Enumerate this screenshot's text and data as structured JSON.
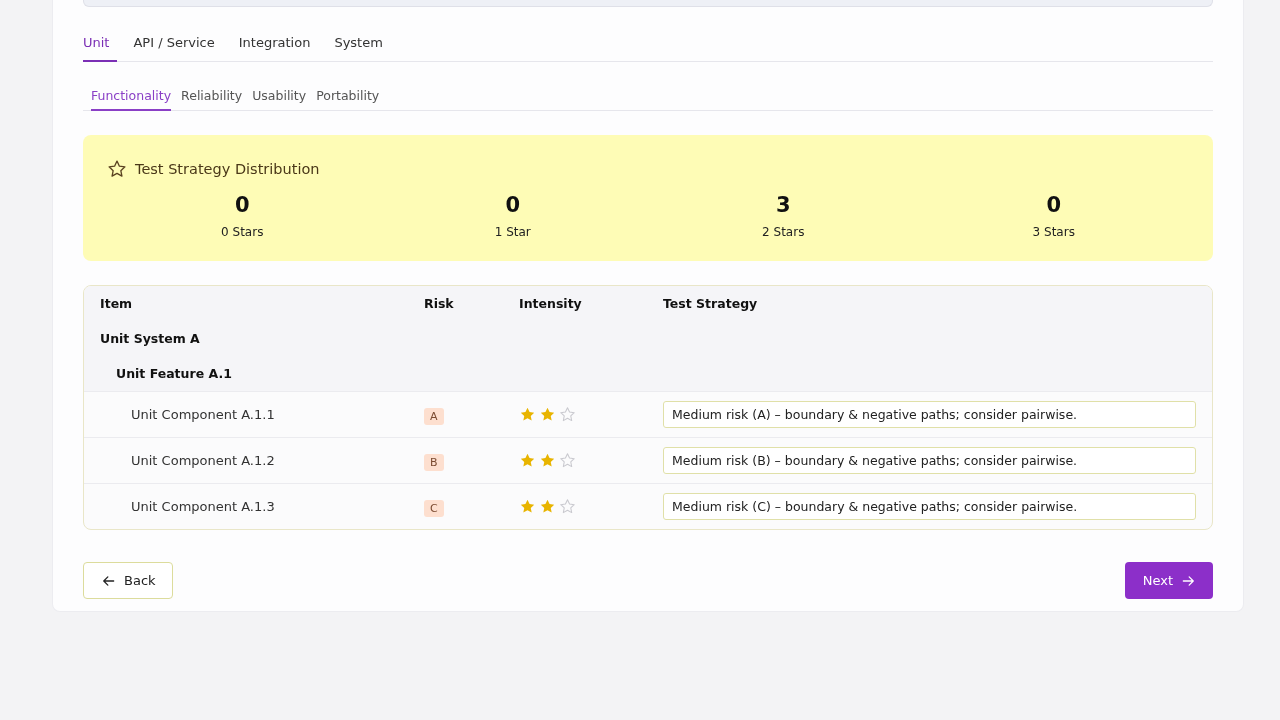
{
  "tabs": [
    {
      "label": "Unit",
      "selected": true
    },
    {
      "label": "API / Service",
      "selected": false
    },
    {
      "label": "Integration",
      "selected": false
    },
    {
      "label": "System",
      "selected": false
    }
  ],
  "subtabs": [
    {
      "label": "Functionality",
      "selected": true
    },
    {
      "label": "Reliability",
      "selected": false
    },
    {
      "label": "Usability",
      "selected": false
    },
    {
      "label": "Portability",
      "selected": false
    }
  ],
  "distribution": {
    "title": "Test Strategy Distribution",
    "stats": [
      {
        "value": "0",
        "label": "0 Stars"
      },
      {
        "value": "0",
        "label": "1 Star"
      },
      {
        "value": "3",
        "label": "2 Stars"
      },
      {
        "value": "0",
        "label": "3 Stars"
      }
    ]
  },
  "table": {
    "columns": [
      "Item",
      "Risk",
      "Intensity",
      "Test Strategy"
    ],
    "rows": [
      {
        "name": "Unit System A",
        "children": [
          {
            "name": "Unit Feature A.1",
            "children": [
              {
                "name": "Unit Component A.1.1",
                "risk": "A",
                "stars": 2,
                "strategy": "Medium risk (A) – boundary & negative paths; consider pairwise."
              },
              {
                "name": "Unit Component A.1.2",
                "risk": "B",
                "stars": 2,
                "strategy": "Medium risk (B) – boundary & negative paths; consider pairwise."
              },
              {
                "name": "Unit Component A.1.3",
                "risk": "C",
                "stars": 2,
                "strategy": "Medium risk (C) – boundary & negative paths; consider pairwise."
              }
            ]
          }
        ]
      }
    ]
  },
  "buttons": {
    "back": "Back",
    "next": "Next"
  }
}
